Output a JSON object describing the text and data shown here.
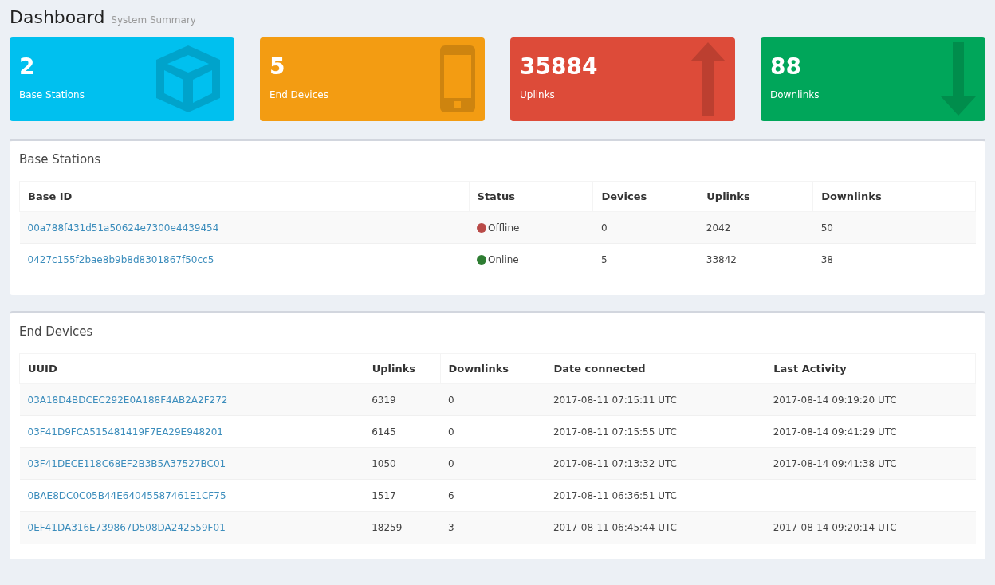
{
  "header": {
    "title": "Dashboard",
    "subtitle": "System Summary"
  },
  "stat_cards": [
    {
      "value": "2",
      "label": "Base Stations",
      "color": "#00c0ef",
      "kind": "cube"
    },
    {
      "value": "5",
      "label": "End Devices",
      "color": "#f39c12",
      "kind": "phone"
    },
    {
      "value": "35884",
      "label": "Uplinks",
      "color": "#dd4b39",
      "kind": "arrow-up"
    },
    {
      "value": "88",
      "label": "Downlinks",
      "color": "#00a65a",
      "kind": "arrow-down"
    }
  ],
  "base_stations": {
    "title": "Base Stations",
    "columns": [
      "Base ID",
      "Status",
      "Devices",
      "Uplinks",
      "Downlinks"
    ],
    "rows": [
      {
        "base_id": "00a788f431d51a50624e7300e4439454",
        "status": "Offline",
        "color": "#b94a48",
        "devices": "0",
        "uplinks": "2042",
        "downlinks": "50"
      },
      {
        "base_id": "0427c155f2bae8b9b8d8301867f50cc5",
        "status": "Online",
        "color": "#2e7d32",
        "devices": "5",
        "uplinks": "33842",
        "downlinks": "38"
      }
    ]
  },
  "end_devices": {
    "title": "End Devices",
    "columns": [
      "UUID",
      "Uplinks",
      "Downlinks",
      "Date connected",
      "Last Activity"
    ],
    "rows": [
      {
        "uuid": "03A18D4BDCEC292E0A188F4AB2A2F272",
        "uplinks": "6319",
        "downlinks": "0",
        "date_connected": "2017-08-11 07:15:11 UTC",
        "last_activity": "2017-08-14 09:19:20 UTC"
      },
      {
        "uuid": "03F41D9FCA515481419F7EA29E948201",
        "uplinks": "6145",
        "downlinks": "0",
        "date_connected": "2017-08-11 07:15:55 UTC",
        "last_activity": "2017-08-14 09:41:29 UTC"
      },
      {
        "uuid": "03F41DECE118C68EF2B3B5A37527BC01",
        "uplinks": "1050",
        "downlinks": "0",
        "date_connected": "2017-08-11 07:13:32 UTC",
        "last_activity": "2017-08-14 09:41:38 UTC"
      },
      {
        "uuid": "0BAE8DC0C05B44E64045587461E1CF75",
        "uplinks": "1517",
        "downlinks": "6",
        "date_connected": "2017-08-11 06:36:51 UTC"
      },
      {
        "uuid": "0EF41DA316E739867D508DA242559F01",
        "uplinks": "18259",
        "downlinks": "3",
        "date_connected": "2017-08-11 06:45:44 UTC",
        "last_activity": "2017-08-14 09:20:14 UTC"
      }
    ]
  }
}
